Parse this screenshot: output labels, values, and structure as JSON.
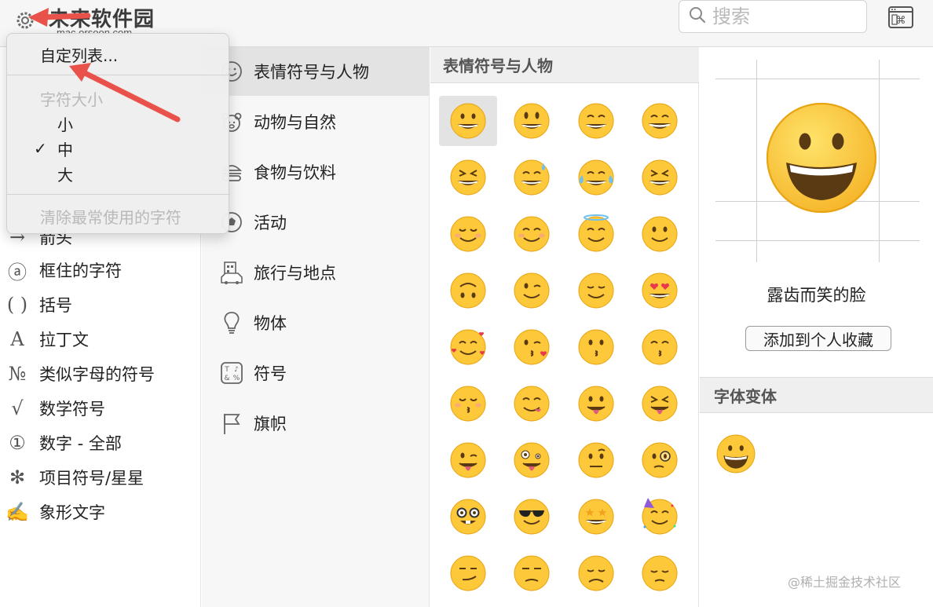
{
  "toolbar": {
    "watermark": "未来软件园",
    "watermark_sub": "mac.orsoon.com",
    "search_placeholder": "搜索"
  },
  "menu": {
    "customize": "自定列表...",
    "font_size_header": "字符大小",
    "sizes": [
      "小",
      "中",
      "大"
    ],
    "selected_size_index": 1,
    "check_mark": "✓",
    "clear_recent": "清除最常使用的字符"
  },
  "sidebar": {
    "items": [
      {
        "icon": "→",
        "label": "箭头"
      },
      {
        "icon": "ⓐ",
        "label": "框住的字符"
      },
      {
        "icon": "( )",
        "label": "括号"
      },
      {
        "icon": "A",
        "label": "拉丁文"
      },
      {
        "icon": "№",
        "label": "类似字母的符号"
      },
      {
        "icon": "√",
        "label": "数学符号"
      },
      {
        "icon": "①",
        "label": "数字 - 全部"
      },
      {
        "icon": "✻",
        "label": "项目符号/星星"
      },
      {
        "icon": "✍",
        "label": "象形文字"
      }
    ]
  },
  "categories": [
    {
      "label": "表情符号与人物",
      "icon": "smiley-outline-icon",
      "selected": true
    },
    {
      "label": "动物与自然",
      "icon": "bear-outline-icon",
      "selected": false
    },
    {
      "label": "食物与饮料",
      "icon": "burger-outline-icon",
      "selected": false
    },
    {
      "label": "活动",
      "icon": "soccer-ball-icon",
      "selected": false
    },
    {
      "label": "旅行与地点",
      "icon": "building-car-icon",
      "selected": false
    },
    {
      "label": "物体",
      "icon": "lightbulb-icon",
      "selected": false
    },
    {
      "label": "符号",
      "icon": "symbols-icon",
      "selected": false
    },
    {
      "label": "旗帜",
      "icon": "flag-icon",
      "selected": false
    }
  ],
  "grid": {
    "title": "表情符号与人物",
    "emojis": [
      "grinning-face",
      "smiley-face",
      "grin-face",
      "beaming-face",
      "squinting-laugh-face",
      "sweat-smile-face",
      "joy-tears-face",
      "rofl-face",
      "relaxed-face",
      "blush-face",
      "halo-face",
      "slight-smile-face",
      "upside-down-face",
      "wink-face",
      "relieved-face",
      "heart-eyes-face",
      "smiling-hearts-face",
      "kiss-heart-face",
      "kissing-face",
      "kissing-smiling-eyes-face",
      "kissing-closed-eyes-face",
      "yum-face",
      "tongue-face",
      "squint-tongue-face",
      "wink-tongue-face",
      "zany-face",
      "raised-eyebrow-face",
      "monocle-face",
      "nerd-face",
      "sunglasses-face",
      "star-struck-face",
      "party-face",
      "smirk-face",
      "unamused-face",
      "disappointed-face",
      "pensive-face"
    ],
    "selected_index": 0
  },
  "detail": {
    "name": "露齿而笑的脸",
    "add_favorite": "添加到个人收藏",
    "variants_title": "字体变体"
  },
  "corner_watermark": "@稀土掘金技术社区",
  "colors": {
    "emoji_yellow": "#FDC93A",
    "emoji_outline": "#E8A412",
    "arrow_red": "#E8524A"
  }
}
